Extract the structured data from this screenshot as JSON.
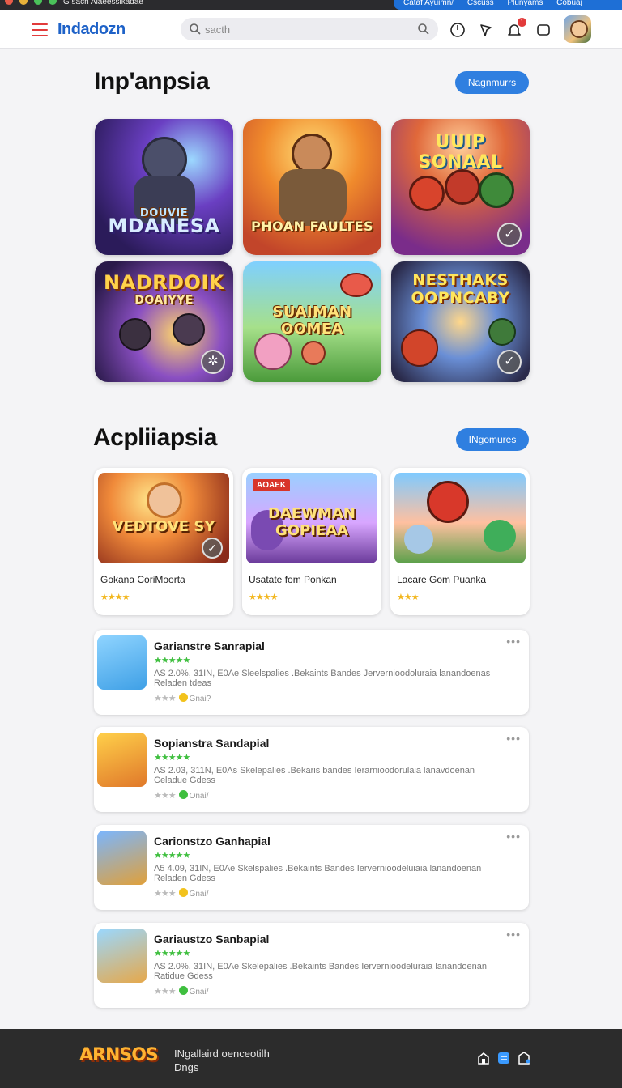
{
  "system_bar": {
    "title": "G sach Alaeessikadae",
    "right_items": [
      "Cataf Ayuimn/",
      "Cscuss",
      "Plunyams",
      "Cobuaj"
    ]
  },
  "header": {
    "logo": "Indadozn",
    "search_placeholder": "sacth",
    "notification_count": "1"
  },
  "featured": {
    "title": "Inp'anpsia",
    "button": "Nagnmurrs",
    "tiles": [
      {
        "caption": "MDANESA",
        "subcaption": "DOUVIE"
      },
      {
        "caption": "PHOAN FAULTES",
        "subcaption": ""
      },
      {
        "caption": "UUIP SONAAL",
        "subcaption": ""
      },
      {
        "caption": "NADRDOIK",
        "subcaption": "DOAIYYE"
      },
      {
        "caption": "SUAIMAN OOMEA",
        "subcaption": ""
      },
      {
        "caption": "NESTHAKS OOPNCABY",
        "subcaption": ""
      }
    ]
  },
  "apps": {
    "title": "Acpliiapsia",
    "button": "INgomures",
    "cards": [
      {
        "caption": "VEDTOVE SY",
        "name": "Gokana CoriMoorta",
        "rating": "★★★★"
      },
      {
        "caption": "DAEWMAN GOPIEAA",
        "tag": "AOAEK",
        "name": "Usatate fom Ponkan",
        "rating": "★★★★"
      },
      {
        "caption": "",
        "name": "Lacare Gom Puanka",
        "rating": "★★★"
      }
    ]
  },
  "list": [
    {
      "title": "Garianstre Sanrapial",
      "stars": "★★★★★",
      "desc": "AS 2.0%, 31IN, E0Ae Sleelspalies .Bekaints Bandes Jervernioodoluraia lanandoenas Reladen tdeas",
      "rating_label": "Gnai?",
      "dot": "#f2c21c"
    },
    {
      "title": "Sopianstra Sandapial",
      "stars": "★★★★★",
      "desc": "AS 2.03, 311N, E0As Skelepalies .Bekaris bandes Ierarnioodorulaia lanavdoenan Celadue Gdess",
      "rating_label": "Onai/",
      "dot": "#3fbf3f"
    },
    {
      "title": "Carionstzo Ganhapial",
      "stars": "★★★★★",
      "desc": "A5 4.09, 31IN, E0Ae Skelspalies .Bekaints Bandes Iervernioodeluiaia lanandoenan Reladen Gdess",
      "rating_label": "Gnai/",
      "dot": "#f2c21c"
    },
    {
      "title": "Gariaustzo Sanbapial",
      "stars": "★★★★★",
      "desc": "AS 2.0%, 31IN, E0Ae Skelepalies .Bekaints Bandes Iervernioodeluraia lanandoenan Ratidue Gdess",
      "rating_label": "Gnai/",
      "dot": "#3fbf3f"
    }
  ],
  "footer": {
    "logo": "ARNSOS",
    "line1": "INgallaird oenceotilh",
    "line2": "Dngs"
  }
}
